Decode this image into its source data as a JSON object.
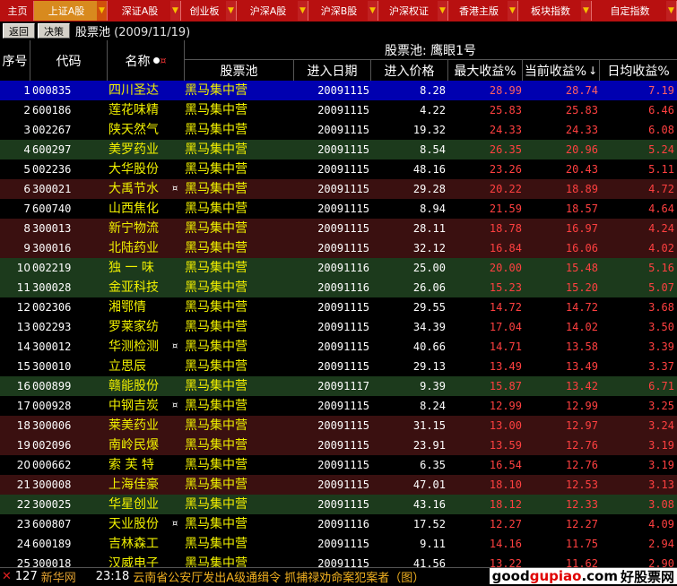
{
  "tabs": [
    {
      "label": "主页",
      "active": false,
      "arrow": false
    },
    {
      "label": "上证A股",
      "active": true,
      "arrow": true
    },
    {
      "label": "深证A股",
      "active": false,
      "arrow": true
    },
    {
      "label": "创业板",
      "active": false,
      "arrow": true
    },
    {
      "label": "沪深A股",
      "active": false,
      "arrow": true
    },
    {
      "label": "沪深B股",
      "active": false,
      "arrow": true
    },
    {
      "label": "沪深权证",
      "active": false,
      "arrow": true
    },
    {
      "label": "香港主版",
      "active": false,
      "arrow": true
    },
    {
      "label": "板块指数",
      "active": false,
      "arrow": true
    },
    {
      "label": "自定指数",
      "active": false,
      "arrow": true
    }
  ],
  "toolbar": {
    "back_label": "返回",
    "decision_label": "决策",
    "pool_title": "股票池",
    "pool_date": "(2009/11/19)"
  },
  "header": {
    "pool_name": "股票池: 鹰眼1号",
    "col_idx": "序号",
    "col_code": "代码",
    "col_name": "名称",
    "col_pool": "股票池",
    "col_date": "进入日期",
    "col_price": "进入价格",
    "col_max": "最大收益%",
    "col_cur": "当前收益%",
    "col_cur_sort": "↓",
    "col_daily": "日均收益%",
    "name_mark": "¤"
  },
  "colors": {
    "row_a": "#000000",
    "row_b": "#1c3a1c",
    "row_c": "#3a1010",
    "selected": "#0000b0",
    "highlight_col": "#0000a8"
  },
  "rows": [
    {
      "idx": "1",
      "code": "000835",
      "name": "四川圣达",
      "mark": "",
      "pool": "黑马集中营",
      "date": "20091115",
      "price": "8.28",
      "max": "28.99",
      "cur": "28.74",
      "daily": "7.19",
      "bg": "sel"
    },
    {
      "idx": "2",
      "code": "600186",
      "name": "莲花味精",
      "mark": "",
      "pool": "黑马集中营",
      "date": "20091115",
      "price": "4.22",
      "max": "25.83",
      "cur": "25.83",
      "daily": "6.46",
      "bg": "a"
    },
    {
      "idx": "3",
      "code": "002267",
      "name": "陕天然气",
      "mark": "",
      "pool": "黑马集中营",
      "date": "20091115",
      "price": "19.32",
      "max": "24.33",
      "cur": "24.33",
      "daily": "6.08",
      "bg": "a"
    },
    {
      "idx": "4",
      "code": "600297",
      "name": "美罗药业",
      "mark": "",
      "pool": "黑马集中营",
      "date": "20091115",
      "price": "8.54",
      "max": "26.35",
      "cur": "20.96",
      "daily": "5.24",
      "bg": "b"
    },
    {
      "idx": "5",
      "code": "002236",
      "name": "大华股份",
      "mark": "",
      "pool": "黑马集中营",
      "date": "20091115",
      "price": "48.16",
      "max": "23.26",
      "cur": "20.43",
      "daily": "5.11",
      "bg": "a"
    },
    {
      "idx": "6",
      "code": "300021",
      "name": "大禹节水",
      "mark": "¤",
      "pool": "黑马集中营",
      "date": "20091115",
      "price": "29.28",
      "max": "20.22",
      "cur": "18.89",
      "daily": "4.72",
      "bg": "c"
    },
    {
      "idx": "7",
      "code": "600740",
      "name": "山西焦化",
      "mark": "",
      "pool": "黑马集中营",
      "date": "20091115",
      "price": "8.94",
      "max": "21.59",
      "cur": "18.57",
      "daily": "4.64",
      "bg": "a"
    },
    {
      "idx": "8",
      "code": "300013",
      "name": "新宁物流",
      "mark": "",
      "pool": "黑马集中营",
      "date": "20091115",
      "price": "28.11",
      "max": "18.78",
      "cur": "16.97",
      "daily": "4.24",
      "bg": "c"
    },
    {
      "idx": "9",
      "code": "300016",
      "name": "北陆药业",
      "mark": "",
      "pool": "黑马集中营",
      "date": "20091115",
      "price": "32.12",
      "max": "16.84",
      "cur": "16.06",
      "daily": "4.02",
      "bg": "c"
    },
    {
      "idx": "10",
      "code": "002219",
      "name": "独 一 味",
      "mark": "",
      "pool": "黑马集中营",
      "date": "20091116",
      "price": "25.00",
      "max": "20.00",
      "cur": "15.48",
      "daily": "5.16",
      "bg": "b"
    },
    {
      "idx": "11",
      "code": "300028",
      "name": "金亚科技",
      "mark": "",
      "pool": "黑马集中营",
      "date": "20091116",
      "price": "26.06",
      "max": "15.23",
      "cur": "15.20",
      "daily": "5.07",
      "bg": "b"
    },
    {
      "idx": "12",
      "code": "002306",
      "name": "湘鄂情",
      "mark": "",
      "pool": "黑马集中营",
      "date": "20091115",
      "price": "29.55",
      "max": "14.72",
      "cur": "14.72",
      "daily": "3.68",
      "bg": "a"
    },
    {
      "idx": "13",
      "code": "002293",
      "name": "罗莱家纺",
      "mark": "",
      "pool": "黑马集中营",
      "date": "20091115",
      "price": "34.39",
      "max": "17.04",
      "cur": "14.02",
      "daily": "3.50",
      "bg": "a"
    },
    {
      "idx": "14",
      "code": "300012",
      "name": "华测检测",
      "mark": "¤",
      "pool": "黑马集中营",
      "date": "20091115",
      "price": "40.66",
      "max": "14.71",
      "cur": "13.58",
      "daily": "3.39",
      "bg": "a"
    },
    {
      "idx": "15",
      "code": "300010",
      "name": "立思辰",
      "mark": "",
      "pool": "黑马集中营",
      "date": "20091115",
      "price": "29.13",
      "max": "13.49",
      "cur": "13.49",
      "daily": "3.37",
      "bg": "a"
    },
    {
      "idx": "16",
      "code": "000899",
      "name": "赣能股份",
      "mark": "",
      "pool": "黑马集中营",
      "date": "20091117",
      "price": "9.39",
      "max": "15.87",
      "cur": "13.42",
      "daily": "6.71",
      "bg": "b"
    },
    {
      "idx": "17",
      "code": "000928",
      "name": "中钢吉炭",
      "mark": "¤",
      "pool": "黑马集中营",
      "date": "20091115",
      "price": "8.24",
      "max": "12.99",
      "cur": "12.99",
      "daily": "3.25",
      "bg": "a"
    },
    {
      "idx": "18",
      "code": "300006",
      "name": "莱美药业",
      "mark": "",
      "pool": "黑马集中营",
      "date": "20091115",
      "price": "31.15",
      "max": "13.00",
      "cur": "12.97",
      "daily": "3.24",
      "bg": "c"
    },
    {
      "idx": "19",
      "code": "002096",
      "name": "南岭民爆",
      "mark": "",
      "pool": "黑马集中营",
      "date": "20091115",
      "price": "23.91",
      "max": "13.59",
      "cur": "12.76",
      "daily": "3.19",
      "bg": "c"
    },
    {
      "idx": "20",
      "code": "000662",
      "name": "索 芙 特",
      "mark": "",
      "pool": "黑马集中营",
      "date": "20091115",
      "price": "6.35",
      "max": "16.54",
      "cur": "12.76",
      "daily": "3.19",
      "bg": "a"
    },
    {
      "idx": "21",
      "code": "300008",
      "name": "上海佳豪",
      "mark": "",
      "pool": "黑马集中营",
      "date": "20091115",
      "price": "47.01",
      "max": "18.10",
      "cur": "12.53",
      "daily": "3.13",
      "bg": "c"
    },
    {
      "idx": "22",
      "code": "300025",
      "name": "华星创业",
      "mark": "",
      "pool": "黑马集中营",
      "date": "20091115",
      "price": "43.16",
      "max": "18.12",
      "cur": "12.33",
      "daily": "3.08",
      "bg": "b"
    },
    {
      "idx": "23",
      "code": "600807",
      "name": "天业股份",
      "mark": "¤",
      "pool": "黑马集中营",
      "date": "20091116",
      "price": "17.52",
      "max": "12.27",
      "cur": "12.27",
      "daily": "4.09",
      "bg": "a"
    },
    {
      "idx": "24",
      "code": "600189",
      "name": "吉林森工",
      "mark": "",
      "pool": "黑马集中营",
      "date": "20091115",
      "price": "9.11",
      "max": "14.16",
      "cur": "11.75",
      "daily": "2.94",
      "bg": "a"
    },
    {
      "idx": "25",
      "code": "300018",
      "name": "汉威电子",
      "mark": "",
      "pool": "黑马集中营",
      "date": "20091115",
      "price": "41.56",
      "max": "13.22",
      "cur": "11.62",
      "daily": "2.90",
      "bg": "a"
    }
  ],
  "bottom": {
    "close": "✕",
    "count": "127",
    "source": "新华网",
    "time": "23:18",
    "headline": "云南省公安厅发出A级通缉令 抓捕禄劝命案犯案者（图）",
    "brand_a": "good",
    "brand_b": "gupiao",
    "brand_c": ".com",
    "brand_d": "好股票网"
  }
}
